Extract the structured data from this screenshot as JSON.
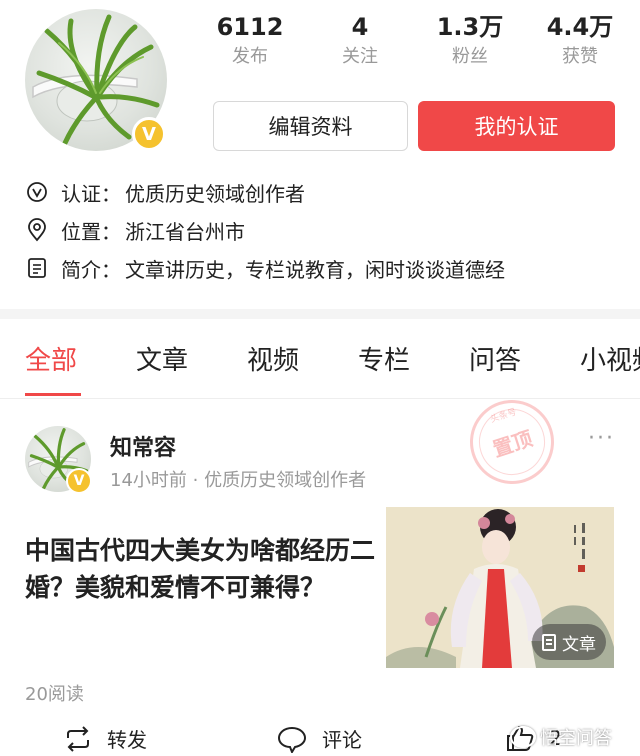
{
  "profile": {
    "stats": [
      {
        "value": "6112",
        "label": "发布"
      },
      {
        "value": "4",
        "label": "关注"
      },
      {
        "value": "1.3万",
        "label": "粉丝"
      },
      {
        "value": "4.4万",
        "label": "获赞"
      }
    ],
    "edit_button": "编辑资料",
    "cert_button": "我的认证",
    "badge_letter": "V",
    "info": [
      {
        "icon": "verified-icon",
        "key": "认证：",
        "value": "优质历史领域创作者"
      },
      {
        "icon": "location-pin-icon",
        "key": "位置：",
        "value": "浙江省台州市"
      },
      {
        "icon": "document-icon",
        "key": "简介：",
        "value": "文章讲历史，专栏说教育，闲时谈谈道德经"
      }
    ]
  },
  "tabs": [
    "全部",
    "文章",
    "视频",
    "专栏",
    "问答",
    "小视频"
  ],
  "active_tab": 0,
  "post": {
    "author": "知常容",
    "meta": "14小时前 · 优质历史领域创作者",
    "more": "···",
    "stamp_top": "头条号",
    "stamp_text": "置顶",
    "headline": "中国古代四大美女为啥都经历二婚？美貌和爱情不可兼得？",
    "thumb_label": "文章",
    "reads": "20阅读",
    "actions": {
      "repost": "转发",
      "comment": "评论",
      "like_count": "2"
    }
  },
  "watermark": "悟空问答",
  "colors": {
    "accent": "#f04848",
    "badge": "#f5c22e",
    "muted": "#999999"
  }
}
